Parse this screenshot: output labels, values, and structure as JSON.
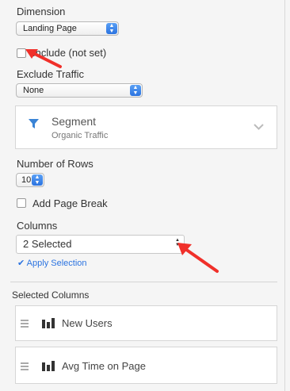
{
  "dimension": {
    "label": "Dimension",
    "value": "Landing Page"
  },
  "include_not_set": {
    "label": "Include (not set)"
  },
  "exclude_traffic": {
    "label": "Exclude Traffic",
    "value": "None"
  },
  "segment": {
    "title": "Segment",
    "subtitle": "Organic Traffic"
  },
  "rows": {
    "label": "Number of Rows",
    "value": "10"
  },
  "page_break": {
    "label": "Add Page Break"
  },
  "columns": {
    "label": "Columns",
    "value": "2 Selected",
    "apply": "Apply Selection"
  },
  "selected_columns": {
    "label": "Selected Columns",
    "items": [
      {
        "label": "New Users"
      },
      {
        "label": "Avg Time on Page"
      }
    ]
  },
  "colors": {
    "accent": "#2b73e0",
    "filter_icon": "#3a84d6",
    "arrow": "#f0302a"
  }
}
